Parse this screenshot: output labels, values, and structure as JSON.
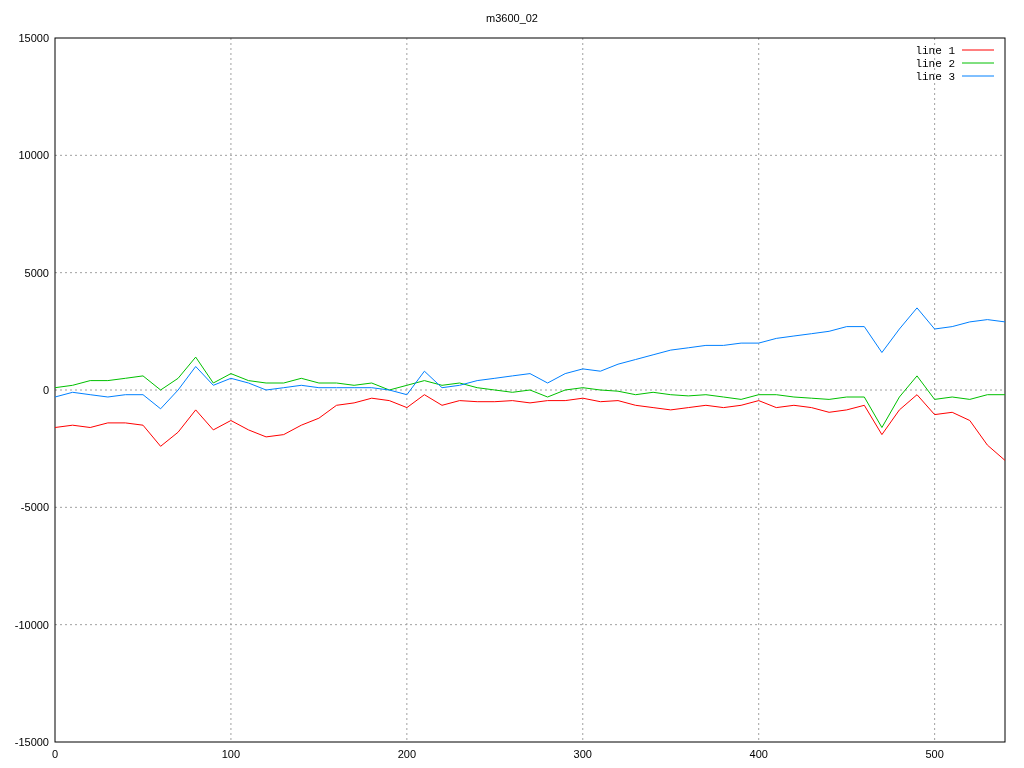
{
  "chart": {
    "chart_data": {
      "type": "line",
      "title": "m3600_02",
      "grid": true,
      "legend": true,
      "xlim": [
        0,
        540
      ],
      "ylim": [
        -15000,
        15000
      ],
      "xticks": [
        0,
        100,
        200,
        300,
        400,
        500
      ],
      "yticks": [
        -15000,
        -10000,
        -5000,
        0,
        5000,
        10000,
        15000
      ],
      "x": [
        0,
        10,
        20,
        30,
        40,
        50,
        60,
        70,
        80,
        90,
        100,
        110,
        120,
        130,
        140,
        150,
        160,
        170,
        180,
        190,
        200,
        210,
        220,
        230,
        240,
        250,
        260,
        270,
        280,
        290,
        300,
        310,
        320,
        330,
        340,
        350,
        360,
        370,
        380,
        390,
        400,
        410,
        420,
        430,
        440,
        450,
        460,
        470,
        480,
        490,
        500,
        510,
        520,
        530,
        540
      ],
      "series": [
        {
          "name": "line 1",
          "color": "#ff0000",
          "values": [
            -1600,
            -1500,
            -1600,
            -1400,
            -1400,
            -1500,
            -2400,
            -1800,
            -850,
            -1700,
            -1300,
            -1700,
            -2000,
            -1900,
            -1500,
            -1200,
            -650,
            -550,
            -350,
            -450,
            -750,
            -200,
            -650,
            -450,
            -500,
            -500,
            -450,
            -550,
            -450,
            -450,
            -350,
            -500,
            -450,
            -650,
            -750,
            -850,
            -750,
            -650,
            -750,
            -650,
            -450,
            -750,
            -650,
            -750,
            -950,
            -850,
            -650,
            -1900,
            -850,
            -200,
            -1050,
            -950,
            -1300,
            -2350,
            -3000
          ]
        },
        {
          "name": "line 2",
          "color": "#00c000",
          "values": [
            100,
            200,
            400,
            400,
            500,
            600,
            0,
            500,
            1400,
            300,
            700,
            400,
            300,
            300,
            500,
            300,
            300,
            200,
            300,
            0,
            200,
            400,
            200,
            300,
            100,
            0,
            -100,
            0,
            -300,
            0,
            100,
            0,
            -50,
            -200,
            -100,
            -200,
            -250,
            -200,
            -300,
            -400,
            -200,
            -200,
            -300,
            -350,
            -400,
            -300,
            -300,
            -1600,
            -300,
            600,
            -400,
            -300,
            -400,
            -200,
            -200
          ]
        },
        {
          "name": "line 3",
          "color": "#0080ff",
          "values": [
            -300,
            -100,
            -200,
            -300,
            -200,
            -200,
            -800,
            0,
            1000,
            200,
            500,
            300,
            0,
            100,
            200,
            100,
            100,
            100,
            100,
            0,
            -200,
            800,
            100,
            200,
            400,
            500,
            600,
            700,
            300,
            700,
            900,
            800,
            1100,
            1300,
            1500,
            1700,
            1800,
            1900,
            1900,
            2000,
            2000,
            2200,
            2300,
            2400,
            2500,
            2700,
            2700,
            1600,
            2600,
            3500,
            2600,
            2700,
            2900,
            3000,
            2900
          ]
        }
      ]
    }
  }
}
